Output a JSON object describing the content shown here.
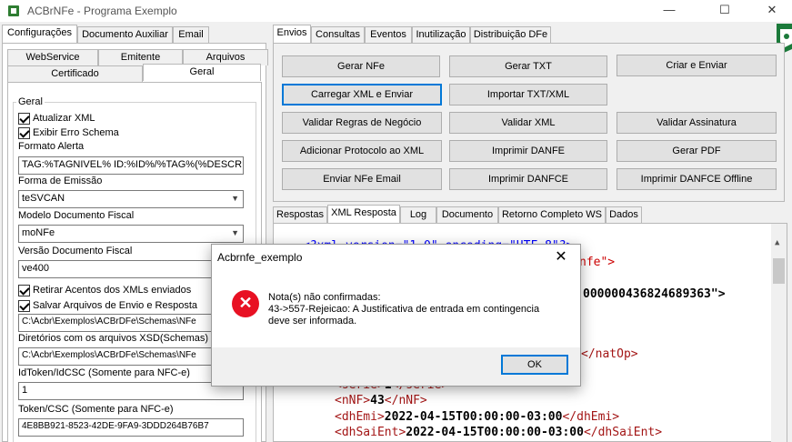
{
  "window": {
    "title": "ACBrNFe - Programa Exemplo",
    "minimize_glyph": "—",
    "maximize_glyph": "☐",
    "close_glyph": "✕"
  },
  "left": {
    "tabs_row1": [
      "Configurações",
      "Documento Auxiliar",
      "Email"
    ],
    "tabs_row2": [
      "WebService",
      "Emitente",
      "Arquivos"
    ],
    "tabs_row3": [
      "Certificado",
      "Geral"
    ],
    "group_title": "Geral",
    "atualizar_xml": "Atualizar XML",
    "exibir_erro": "Exibir Erro Schema",
    "formato_alerta_label": "Formato Alerta",
    "formato_alerta_value": "TAG:%TAGNIVEL% ID:%ID%/%TAG%(%DESCRI",
    "forma_emissao_label": "Forma de Emissão",
    "forma_emissao_value": "teSVCAN",
    "modelo_label": "Modelo Documento Fiscal",
    "modelo_value": "moNFe",
    "versao_label": "Versão Documento Fiscal",
    "versao_value": "ve400",
    "retirar_acentos": "Retirar Acentos dos XMLs enviados",
    "salvar_arquivos": "Salvar Arquivos de Envio e Resposta",
    "path_value": "C:\\Acbr\\Exemplos\\ACBrDFe\\Schemas\\NFe",
    "dir_xsd_label": "Diretórios com os arquivos XSD(Schemas)",
    "dir_xsd_value": "C:\\Acbr\\Exemplos\\ACBrDFe\\Schemas\\NFe",
    "idtoken_label": "IdToken/IdCSC (Somente para NFC-e)",
    "idtoken_value": "1",
    "token_label": "Token/CSC (Somente para NFC-e)",
    "token_value": "4E8BB921-8523-42DE-9FA9-3DDD264B76B7"
  },
  "right": {
    "tabs_top": [
      "Envios",
      "Consultas",
      "Eventos",
      "Inutilização",
      "Distribuição DFe"
    ],
    "buttons": {
      "gerar_nfe": "Gerar NFe",
      "gerar_txt": "Gerar TXT",
      "criar_enviar": "Criar e Enviar",
      "carregar_xml": "Carregar XML e Enviar",
      "importar_txt": "Importar TXT/XML",
      "validar_regras": "Validar Regras de Negócio",
      "validar_xml": "Validar XML",
      "validar_assinatura": "Validar Assinatura",
      "adicionar_protocolo": "Adicionar Protocolo ao XML",
      "imprimir_danfe": "Imprimir DANFE",
      "gerar_pdf": "Gerar PDF",
      "enviar_email": "Enviar NFe Email",
      "imprimir_danfce": "Imprimir DANFCE",
      "imprimir_danfce_offline": "Imprimir DANFCE Offline"
    },
    "tabs_bottom": [
      "Respostas",
      "XML Resposta",
      "Log",
      "Documento",
      "Retorno Completo WS",
      "Dados"
    ],
    "xml_lines": {
      "l1": "<?xml version=\"1.0\" encoding=\"UTF-8\"?>",
      "l2_tail": "nfe\">",
      "l3_tail": "000000436824689363\">",
      "l5_tail": "</natOp>",
      "serie_open": "<serie>",
      "serie_val": "1",
      "serie_close": "</serie>",
      "nnf_open": "<nNF>",
      "nnf_val": "43",
      "nnf_close": "</nNF>",
      "dhemi_open": "<dhEmi>",
      "dhemi_val": "2022-04-15T00:00:00-03:00",
      "dhemi_close": "</dhEmi>",
      "dhsai_open": "<dhSaiEnt>",
      "dhsai_val": "2022-04-15T00:00:00-03:00",
      "dhsai_close": "</dhSaiEnt>"
    }
  },
  "dialog": {
    "title": "Acbrnfe_exemplo",
    "close_glyph": "✕",
    "icon_glyph": "✕",
    "line1": "Nota(s) não confirmadas:",
    "line2": "43->557-Rejeicao: A Justificativa de entrada em contingencia",
    "line3": "deve ser informada.",
    "ok_label": "OK"
  }
}
